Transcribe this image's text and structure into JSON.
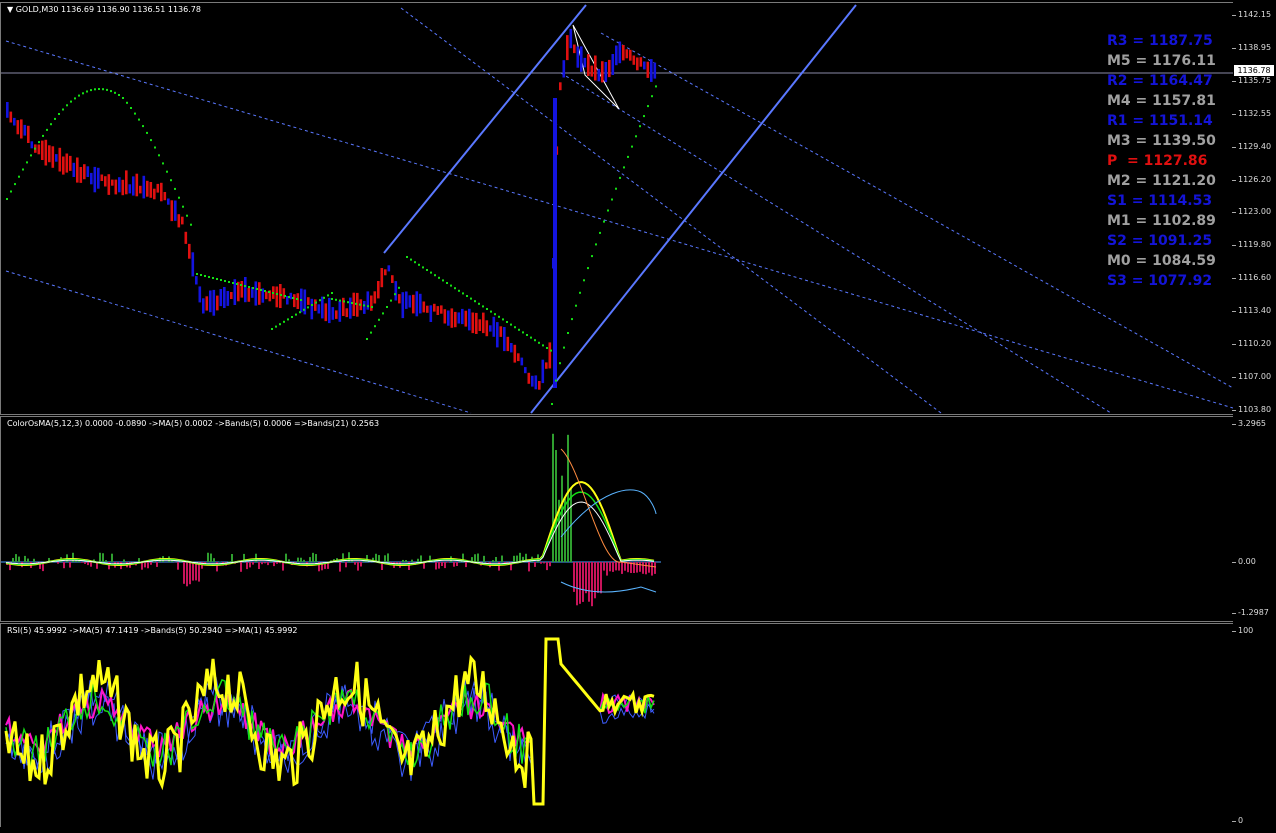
{
  "chart": {
    "title": "GOLD,M30",
    "ohlc": "1136.69 1136.90 1136.51 1136.78",
    "current_price": "1136.78",
    "price_ticks": [
      "1142.15",
      "1138.95",
      "1135.75",
      "1132.55",
      "1129.40",
      "1126.20",
      "1123.00",
      "1119.80",
      "1116.60",
      "1113.40",
      "1110.20",
      "1107.00",
      "1103.80"
    ],
    "levels": [
      {
        "text": "R3 = 1187.75",
        "color": "#1414d8"
      },
      {
        "text": "M5 = 1176.11",
        "color": "#a0a0a0"
      },
      {
        "text": "R2 = 1164.47",
        "color": "#1414d8"
      },
      {
        "text": "M4 = 1157.81",
        "color": "#a0a0a0"
      },
      {
        "text": "R1 = 1151.14",
        "color": "#1414d8"
      },
      {
        "text": "M3 = 1139.50",
        "color": "#a0a0a0"
      },
      {
        "text": "P  = 1127.86",
        "color": "#e01010"
      },
      {
        "text": "M2 = 1121.20",
        "color": "#a0a0a0"
      },
      {
        "text": "S1 = 1114.53",
        "color": "#1414d8"
      },
      {
        "text": "M1 = 1102.89",
        "color": "#a0a0a0"
      },
      {
        "text": "S2 = 1091.25",
        "color": "#1414d8"
      },
      {
        "text": "M0 = 1084.59",
        "color": "#a0a0a0"
      },
      {
        "text": "S3 = 1077.92",
        "color": "#1414d8"
      }
    ]
  },
  "osma": {
    "label": "ColorOsMA(5,12,3) 0.0000 -0.0890  ->MA(5) 0.0002  ->Bands(5) 0.0006  =>Bands(21) 0.2563",
    "ticks": [
      "3.2965",
      "0.00",
      "-1.2987"
    ]
  },
  "rsi": {
    "label": "RSI(5) 45.9992  ->MA(5) 47.1419  ->Bands(5) 50.2940  =>MA(1) 45.9992",
    "ticks": [
      "100",
      "0"
    ]
  },
  "colors": {
    "bull": "#1414e0",
    "bear": "#e01010",
    "sar": "#14e014",
    "channel": "#5a78ff",
    "rsi": "#ffff14",
    "ma": "#ff14c8"
  }
}
